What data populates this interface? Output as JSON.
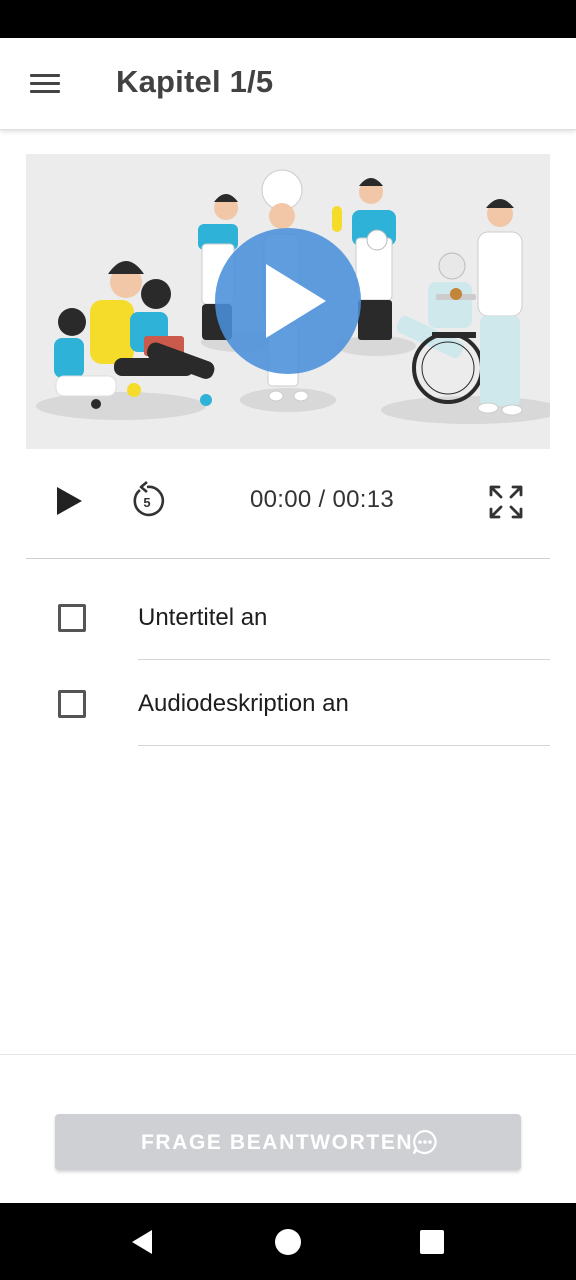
{
  "app_bar": {
    "title": "Kapitel 1/5",
    "menu_icon": "hamburger-menu-icon"
  },
  "video": {
    "overlay_icon": "play-circle-icon",
    "overlay_color": "#4a90d9"
  },
  "player_controls": {
    "play_icon": "play-icon",
    "replay_icon": "replay-5-icon",
    "replay_seconds": "5",
    "time": "00:00 / 00:13",
    "fullscreen_icon": "fullscreen-icon"
  },
  "options": [
    {
      "label": "Untertitel an",
      "checked": false
    },
    {
      "label": "Audiodeskription an",
      "checked": false
    }
  ],
  "answer_button": {
    "label": "FRAGE BEANTWORTEN",
    "icon": "chat-bubble-icon",
    "disabled": true
  },
  "system_nav": {
    "back_icon": "back-triangle-icon",
    "home_icon": "home-circle-icon",
    "recents_icon": "recents-square-icon"
  },
  "colors": {
    "app_bar_text": "#424242",
    "disabled_button": "#cfd0d4",
    "video_background": "#ececec"
  }
}
